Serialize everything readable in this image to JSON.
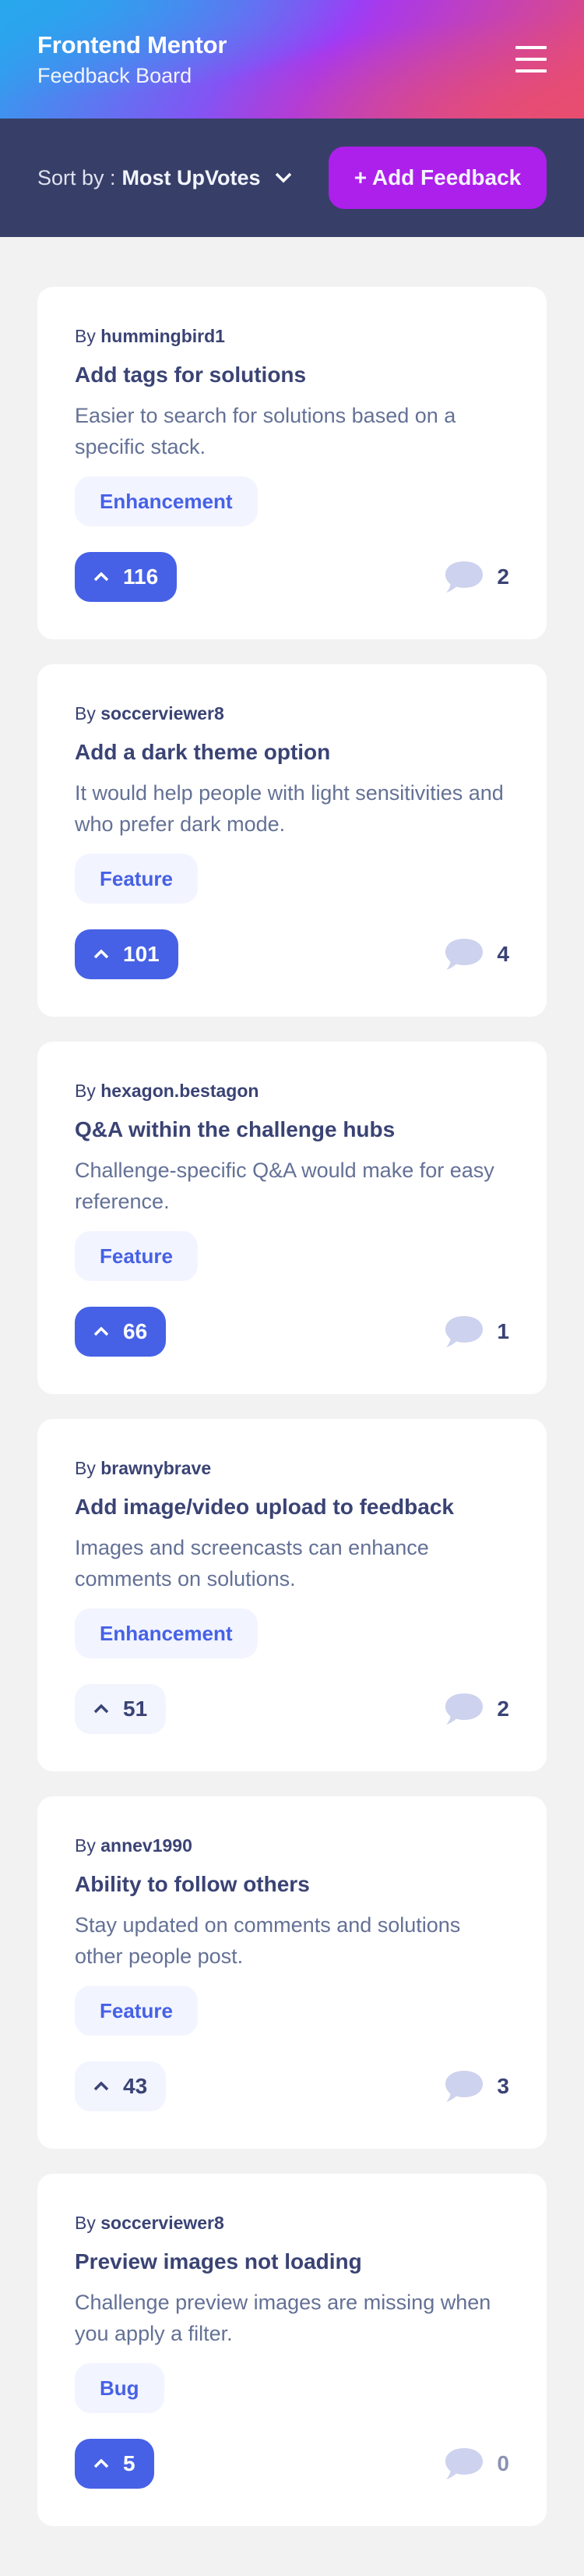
{
  "header": {
    "title": "Frontend Mentor",
    "subtitle": "Feedback Board"
  },
  "sortbar": {
    "label": "Sort by :",
    "value": "Most UpVotes",
    "add_button": "+ Add Feedback"
  },
  "by_label": "By",
  "colors": {
    "accent_blue": "#4661e6",
    "accent_purple": "#ad1fea",
    "dark_navy": "#373f68"
  },
  "feedback": [
    {
      "author": "hummingbird1",
      "title": "Add tags for solutions",
      "description": "Easier to search for solutions based on a specific stack.",
      "tag": "Enhancement",
      "upvotes": "116",
      "upvoted": true,
      "comments": "2"
    },
    {
      "author": "soccerviewer8",
      "title": "Add a dark theme option",
      "description": "It would help people with light sensitivities and who prefer dark mode.",
      "tag": "Feature",
      "upvotes": "101",
      "upvoted": true,
      "comments": "4"
    },
    {
      "author": "hexagon.bestagon",
      "title": "Q&A within the challenge hubs",
      "description": "Challenge-specific Q&A would make for easy reference.",
      "tag": "Feature",
      "upvotes": "66",
      "upvoted": true,
      "comments": "1"
    },
    {
      "author": "brawnybrave",
      "title": "Add image/video upload to feedback",
      "description": "Images and screencasts can enhance comments on solutions.",
      "tag": "Enhancement",
      "upvotes": "51",
      "upvoted": false,
      "comments": "2"
    },
    {
      "author": "annev1990",
      "title": "Ability to follow others",
      "description": "Stay updated on comments and solutions other people post.",
      "tag": "Feature",
      "upvotes": "43",
      "upvoted": false,
      "comments": "3"
    },
    {
      "author": "soccerviewer8",
      "title": "Preview images not loading",
      "description": "Challenge preview images are missing when you apply a filter.",
      "tag": "Bug",
      "upvotes": "5",
      "upvoted": true,
      "comments": "0"
    }
  ]
}
